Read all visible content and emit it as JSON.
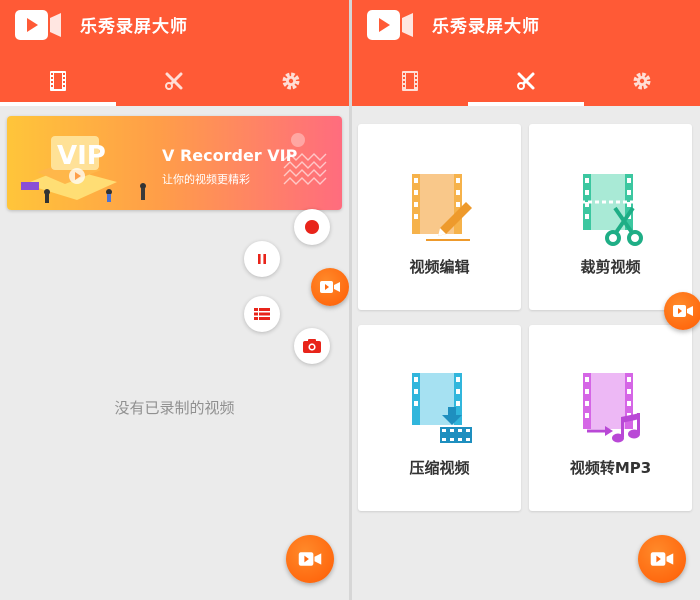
{
  "app": {
    "title": "乐秀录屏大师"
  },
  "tabs": [
    {
      "icon": "film-icon"
    },
    {
      "icon": "tools-icon"
    },
    {
      "icon": "gear-icon"
    }
  ],
  "left_pane": {
    "active_tab": "film",
    "vip_banner": {
      "art_text": "VIP",
      "title": "V Recorder VIP",
      "subtitle": "让你的视频更精彩"
    },
    "floating_controls": [
      {
        "icon": "record-icon"
      },
      {
        "icon": "pause-icon"
      },
      {
        "icon": "list-icon"
      },
      {
        "icon": "camera-icon"
      },
      {
        "icon": "video-camera-icon"
      }
    ],
    "empty_message": "没有已录制的视频"
  },
  "right_pane": {
    "active_tab": "tools",
    "tools": [
      {
        "label": "视频编辑",
        "icon": "video-edit-icon"
      },
      {
        "label": "裁剪视频",
        "icon": "video-trim-icon"
      },
      {
        "label": "压缩视频",
        "icon": "video-compress-icon"
      },
      {
        "label": "视频转MP3",
        "icon": "video-to-mp3-icon"
      }
    ]
  },
  "colors": {
    "brand": "#ff5a36",
    "record": "#e8241a",
    "fab": "#ff6a10",
    "edit": "#f6b24a",
    "trim": "#3cc7a0",
    "compress": "#31b6dc",
    "mp3": "#d566e6"
  }
}
